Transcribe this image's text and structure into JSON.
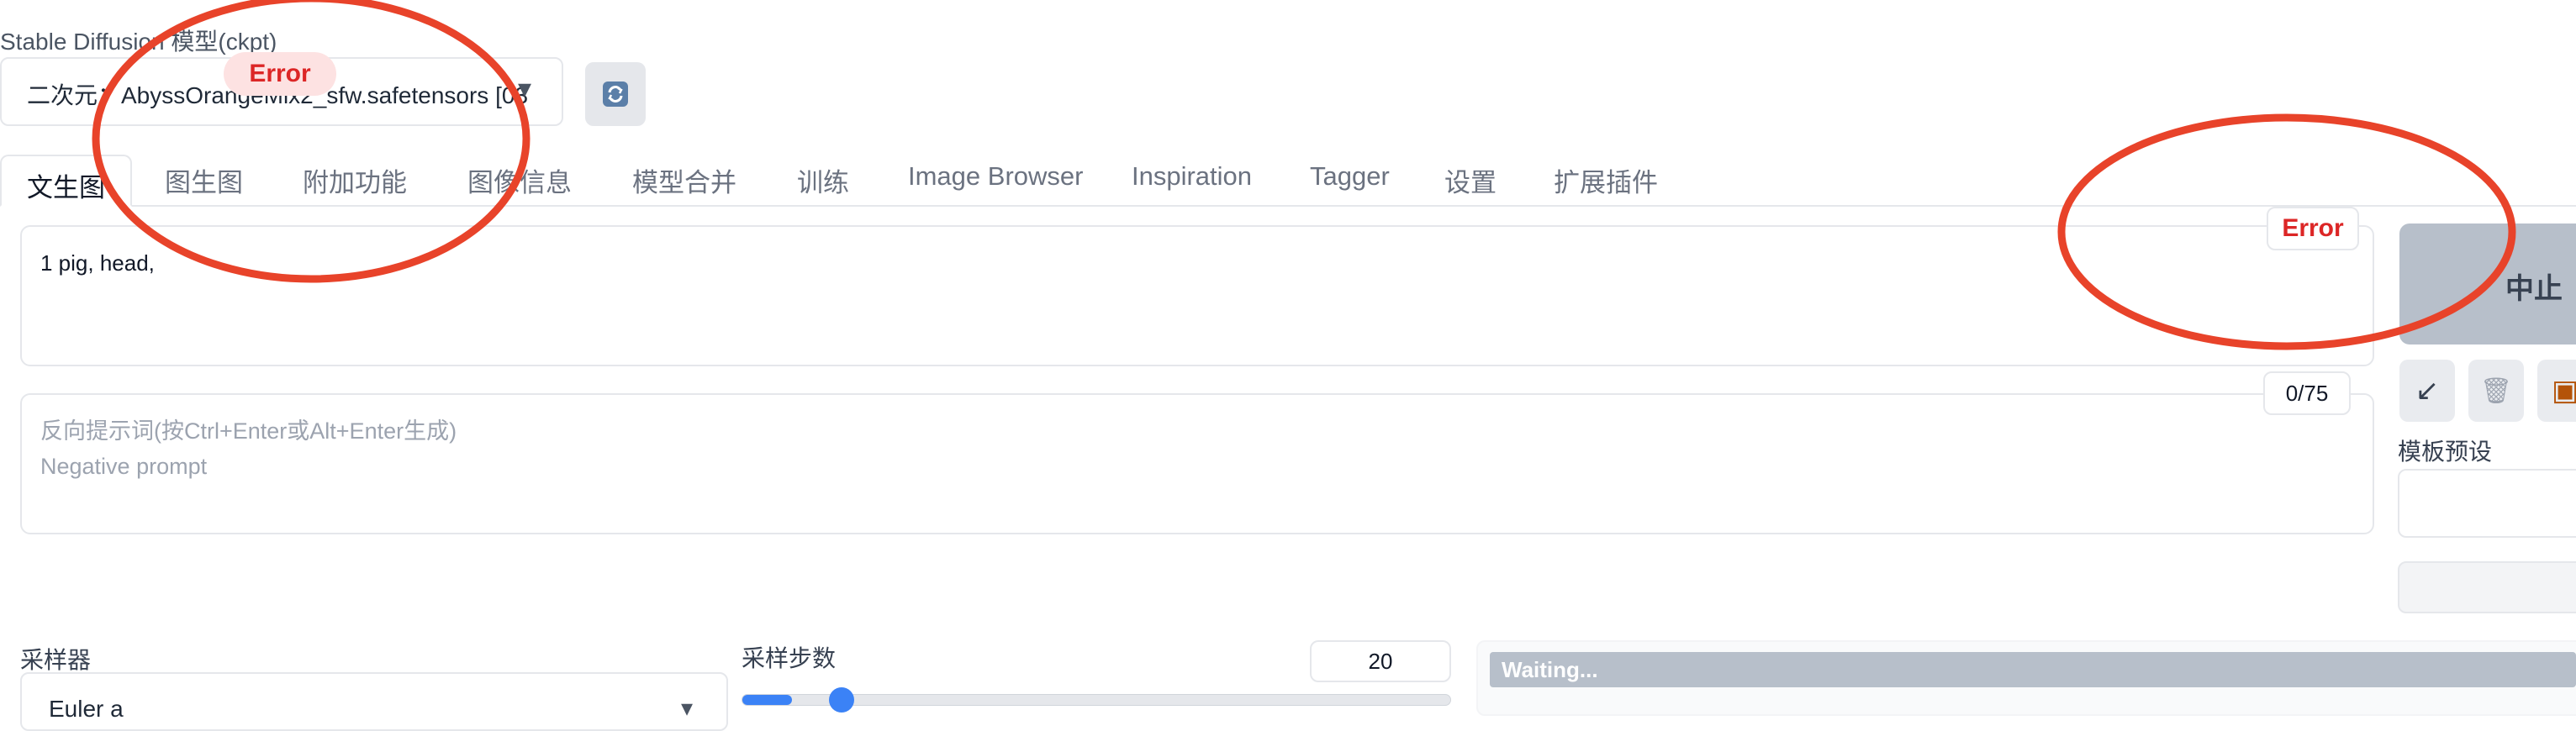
{
  "model": {
    "label": "Stable Diffusion 模型(ckpt)",
    "value": "二次元：AbyssOrangeMix2_sfw.safetensors [03",
    "arrow": "▾",
    "refresh_icon": "refresh-icon"
  },
  "tabs": [
    {
      "label": "文生图",
      "active": true
    },
    {
      "label": "图生图"
    },
    {
      "label": "附加功能"
    },
    {
      "label": "图像信息"
    },
    {
      "label": "模型合并"
    },
    {
      "label": "训练"
    },
    {
      "label": "Image Browser"
    },
    {
      "label": "Inspiration"
    },
    {
      "label": "Tagger"
    },
    {
      "label": "设置"
    },
    {
      "label": "扩展插件"
    }
  ],
  "prompt": {
    "value": "1 pig, head,",
    "token_counter": "Error"
  },
  "negative_prompt": {
    "placeholder_line1": "反向提示词(按Ctrl+Enter或Alt+Enter生成)",
    "placeholder_line2": "Negative prompt",
    "token_counter": "0/75"
  },
  "right_panel": {
    "stop_label": "中止",
    "tool_icons": [
      "arrow-down-left-icon",
      "trash-icon",
      "image-icon"
    ],
    "tool_glyphs": [
      "↙",
      "🗑",
      "▣"
    ],
    "styles_label": "模板预设"
  },
  "sampler": {
    "label": "采样器",
    "value": "Euler a",
    "arrow": "▾"
  },
  "steps": {
    "label": "采样步数",
    "value": "20",
    "progress_fraction": 0.07
  },
  "status": {
    "waiting": "Waiting..."
  },
  "overlay": {
    "error_text": "Error",
    "annotation_color": "#e8432a",
    "error_color": "#dc2626"
  }
}
